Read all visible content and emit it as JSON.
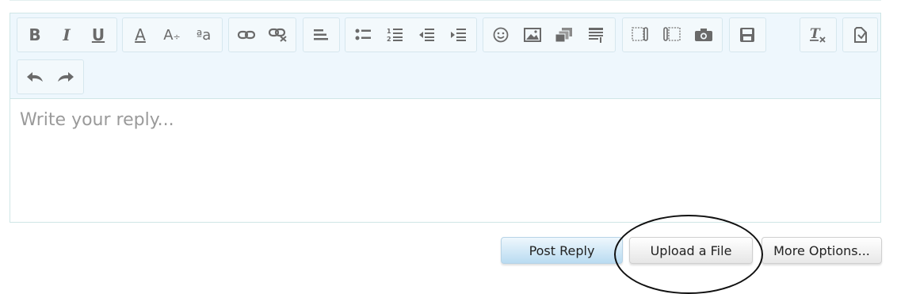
{
  "editor": {
    "placeholder": "Write your reply...",
    "toolbar": {
      "groups": [
        {
          "icons": [
            "bold-icon",
            "italic-icon",
            "underline-icon"
          ]
        },
        {
          "icons": [
            "font-color-icon",
            "font-size-icon",
            "font-family-icon"
          ]
        },
        {
          "icons": [
            "link-icon",
            "unlink-icon"
          ]
        },
        {
          "icons": [
            "align-left-icon"
          ]
        },
        {
          "icons": [
            "bullet-list-icon",
            "numbered-list-icon",
            "outdent-icon",
            "indent-icon"
          ]
        },
        {
          "icons": [
            "smiley-icon",
            "image-icon",
            "media-icon",
            "insert-template-icon"
          ]
        },
        {
          "icons": [
            "quote-icon",
            "code-icon",
            "camera-icon"
          ]
        },
        {
          "icons": [
            "save-draft-icon"
          ]
        },
        {
          "icons": [
            "remove-format-icon"
          ]
        },
        {
          "icons": [
            "toggle-bbcode-icon"
          ]
        },
        {
          "icons": [
            "undo-icon",
            "redo-icon"
          ]
        }
      ]
    }
  },
  "actions": {
    "post_reply": "Post Reply",
    "upload_file": "Upload a File",
    "more_options": "More Options..."
  },
  "colors": {
    "toolbar_bg": "#eef7fd",
    "border": "#cfe6e6",
    "post_button_gradient_bottom": "#b9dbf1",
    "annotation_circle": "#111111"
  }
}
